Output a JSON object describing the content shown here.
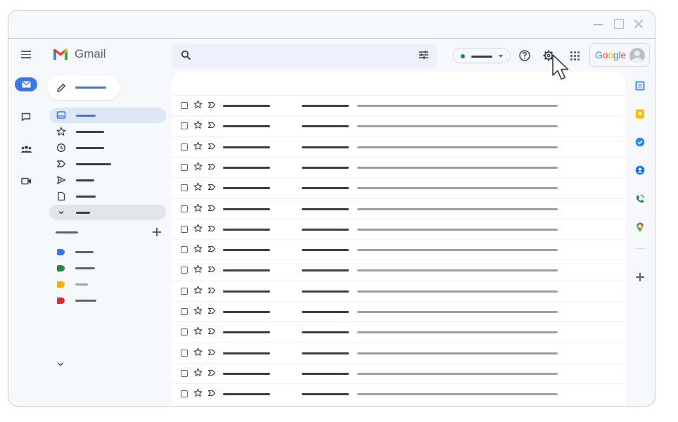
{
  "app": {
    "name": "Gmail"
  },
  "account": {
    "brand": "Google"
  },
  "colors": {
    "accent": "#3b78e7",
    "label_colors": [
      "#3b78e7",
      "#1e8e3e",
      "#f9ab00",
      "#d93025"
    ],
    "status_dot": "#1e8e3e"
  },
  "icons": {
    "rail": [
      "mail-icon",
      "chat-icon",
      "spaces-icon",
      "meet-icon"
    ],
    "nav": [
      "inbox-icon",
      "star-icon",
      "snooze-icon",
      "important-icon",
      "send-icon",
      "draft-icon",
      "chevron-down-icon"
    ],
    "side_apps": [
      "calendar-icon",
      "keep-icon",
      "tasks-icon",
      "contacts-icon",
      "voice-icon",
      "maps-icon"
    ],
    "toolbar": [
      "search-icon",
      "tune-icon",
      "help-icon",
      "settings-icon",
      "apps-icon"
    ]
  },
  "mail_rows": 15
}
